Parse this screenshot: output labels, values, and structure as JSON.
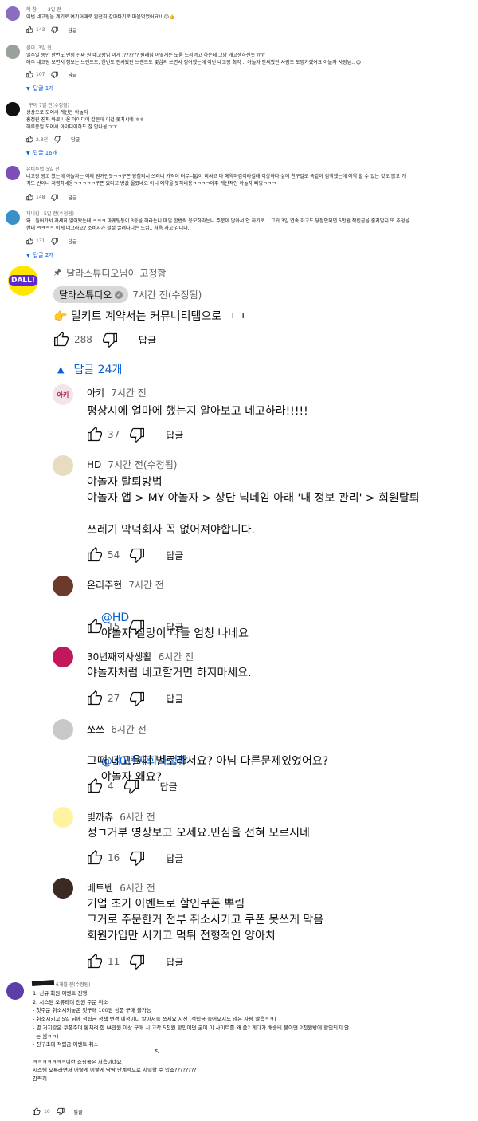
{
  "top": [
    {
      "author": "핵 창",
      "time": "2일 전",
      "text": "이번 네고왕을 계기로 여기어때로 완전히 갈아타기로 마음먹었어요!! 😊👍",
      "likes": "143",
      "reply": "답글"
    },
    {
      "author": "클어",
      "time": "3일 전",
      "text": "일주일 동안 한번도 안힘 진짜 뭔 네고왕임 이게 ;?????? 원래님 어떻게든 도움 드리려고 하는데 그냥 개고생하신듯 ㅠㅠ\n애주 네고왕 보면서 정보는 브랜드도, 한번도 안사봤던 브랜드도 몇십의 쓰면서 정어했는데 이번 네고왕 최악 .. 야놀자 안써봤던 사람도 도망가겠어요 야놀자 사장님.. 😊",
      "likes": "107",
      "reply": "답글",
      "replies": "답글 1개"
    },
    {
      "author": "_꾸이",
      "time": "7일 전(수정됨)",
      "text": "상상으로 모여서 계산은 야놀자\n홍정원 진짜 바로 나온 아이디어 같은데 이걸 못치시네 ㅎㅎ\n하루종일 모여서 아이디어하도 잘 안나옴 ㅜㅜ",
      "likes": "2.3천",
      "reply": "답글",
      "replies": "답글 16개"
    },
    {
      "author": "유비투랩",
      "time": "5일 전",
      "text": "네고왕 왕고 봤는데 야놀자는 이제 원거런듯ㅋㅋ쿠폰 당첨되서 쓰려니 가격이 터무니없이 비싸고 다 예약마감이라길래 이상하다 싶어 친구걸로 똑같이 검색했는데 예약 할 수 있는 것도 많고 가\n격도 반이나 저렴하네용ㅋㅋㅋㅋㅋ쿠폰 있다고 방값 올렸네요 아니 예약을 못하네용ㅋㅋㅋㅋ아주 계산적인 야놀자 빠잉ㅋㅋㅋ",
      "likes": "148",
      "reply": "답글"
    },
    {
      "author": "재니킴",
      "time": "5일 전(수정됨)",
      "text": "와.. 들어가서 자세히 읽어봤는데 ㅋㅋㅋ 마케팅통이 3등을 하라는니 매일 한번씩 응모하라는니 주문이 많아서 안 하기로... 그거 3일 연속 하고도 당첨안되면 5만원 적립금을 줄지말지 또 추첨을\n한대 ㅋㅋㅋㅋ 이게 네고라고? 소비자가 절절 끌려다니는 느낌.. 처음 자고 갑니다..",
      "likes": "131",
      "reply": "답글",
      "replies": "답글 2개"
    }
  ],
  "pinned": {
    "pin_label": "달라스튜디오님이 고정함",
    "author": "달라스튜디오",
    "time": "7시간 전(수정됨)",
    "text": "👉 밀키트 계약서는 커뮤니티탭으로 ㄱㄱ",
    "likes": "288",
    "reply": "답글",
    "replies": "답글 24개",
    "logo_text": "DALL!"
  },
  "replies_lg": [
    {
      "author": "아키",
      "time": "7시간 전",
      "lines": [
        "평상시에 얼마에 했는지 알아보고 네고하라!!!!!"
      ],
      "likes": "37",
      "reply": "답글",
      "avatar_text": "아키"
    },
    {
      "author": "HD",
      "time": "7시간 전(수정됨)",
      "lines": [
        "야놀자 탈퇴방법",
        "야놀자 앱 > MY 야놀자 > 상단 닉네임 아래 '내 정보 관리' > 회원탈퇴",
        "",
        "쓰레기 악덕회사 꼭 없어져야합니다."
      ],
      "likes": "54",
      "reply": "답글"
    },
    {
      "author": "온리주현",
      "time": "7시간 전",
      "mention": "@HD",
      "lines": [
        "야놀자 실망이 다들 엄청 나네요"
      ],
      "likes": "15",
      "reply": "답글"
    },
    {
      "author": "30년째회사생활",
      "time": "6시간 전",
      "lines": [
        "야놀자처럼 네고할거면 하지마세요."
      ],
      "likes": "27",
      "reply": "답글"
    },
    {
      "author": "쏘쏘",
      "time": "6시간 전",
      "mention": "@30년째회사생활",
      "lines": [
        "야놀자 왜요?",
        "그때 네고율이 별로라서요? 아님 다른문제있었어요?"
      ],
      "likes": "4",
      "reply": "답글"
    },
    {
      "author": "빛까츄",
      "time": "6시간 전",
      "lines": [
        "정ㄱ거부 영상보고 오세요.민심을 전혀 모르시네"
      ],
      "likes": "16",
      "reply": "답글"
    },
    {
      "author": "베토벤",
      "time": "6시간 전",
      "lines": [
        "기업 초기 이벤트로 할인쿠폰 뿌림",
        "그거로 주문한거 전부 취소시키고 쿠폰 못쓰게 막음",
        "회원가입만 시키고 먹튀 전형적인 양아치"
      ],
      "likes": "11",
      "reply": "답글"
    }
  ],
  "bottom": {
    "time": "6개월 전(수정됨)",
    "text": "1. 신규 회원 이벤트 진행\n2. 시스템 오류라며 전원 주문 취소\n- 첫주문 취소시키놓곤 첫구매 100원 상품 구매 불가능\n- 취소시키고 5일 뒤에 적립금 정책 변경 예정이니 알아서들 쓰세요 시전 (적립금 들어오지도 않은 사람 많음ㅋㅋ)\n- 별 거지같은 쿠폰주며 통치려 함 (4만원 이상 구매 시 고작 5천원 할인이면 굳이 이 사이트를 왜 씀? 게다가 배송비 붙이면 2천원밖에 할인되지 않\n  는 셈ㅋㅋ)\n- 친구초대 적립금 이벤트 취소\n\nㅋㅋㅋㅋㅋㅋㅋ이런 쇼핑몰은 처음이네요\n시스템 오류라면서 어떻게 이렇게 딱딱 단계적으로 치밀할 수 있죠????????\n간략히",
    "likes": "10",
    "reply": "답글"
  }
}
